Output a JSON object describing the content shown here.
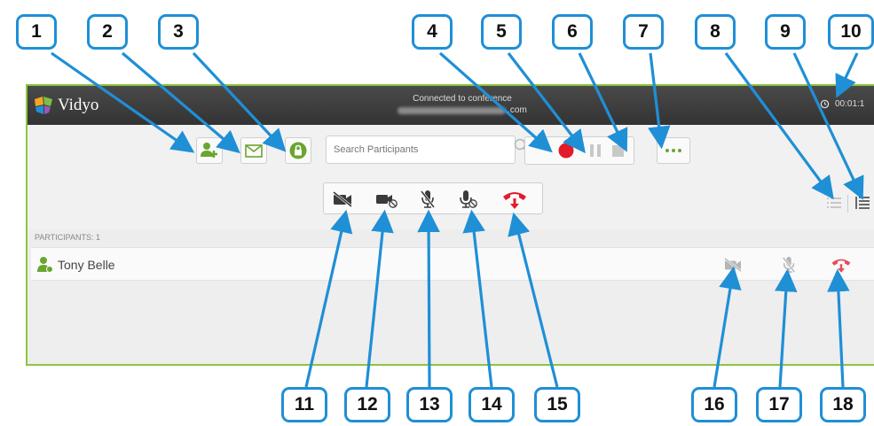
{
  "window": {
    "app_name": "Vidyo",
    "status_line": "Connected to conference",
    "status_suffix": ".com",
    "timer": "00:01:1"
  },
  "toolbar": {
    "search_placeholder": "Search Participants"
  },
  "participants": {
    "header": "PARTICIPANTS: 1",
    "list": [
      {
        "name": "Tony Belle"
      }
    ]
  },
  "callouts": [
    "1",
    "2",
    "3",
    "4",
    "5",
    "6",
    "7",
    "8",
    "9",
    "10",
    "11",
    "12",
    "13",
    "14",
    "15",
    "16",
    "17",
    "18"
  ],
  "icons": {
    "add-participant": "add-participant-icon",
    "invite-email": "envelope-icon",
    "lock": "lock-icon",
    "record": "record-icon",
    "pause": "pause-icon",
    "stop": "stop-icon",
    "more": "more-icon",
    "list-view": "list-view-icon",
    "detail-view": "detail-view-icon"
  },
  "colors": {
    "accent_green": "#8cc63f",
    "callout_blue": "#1f8fd6",
    "record_red": "#e21b2b",
    "titlebar": "#3a3a3a"
  }
}
